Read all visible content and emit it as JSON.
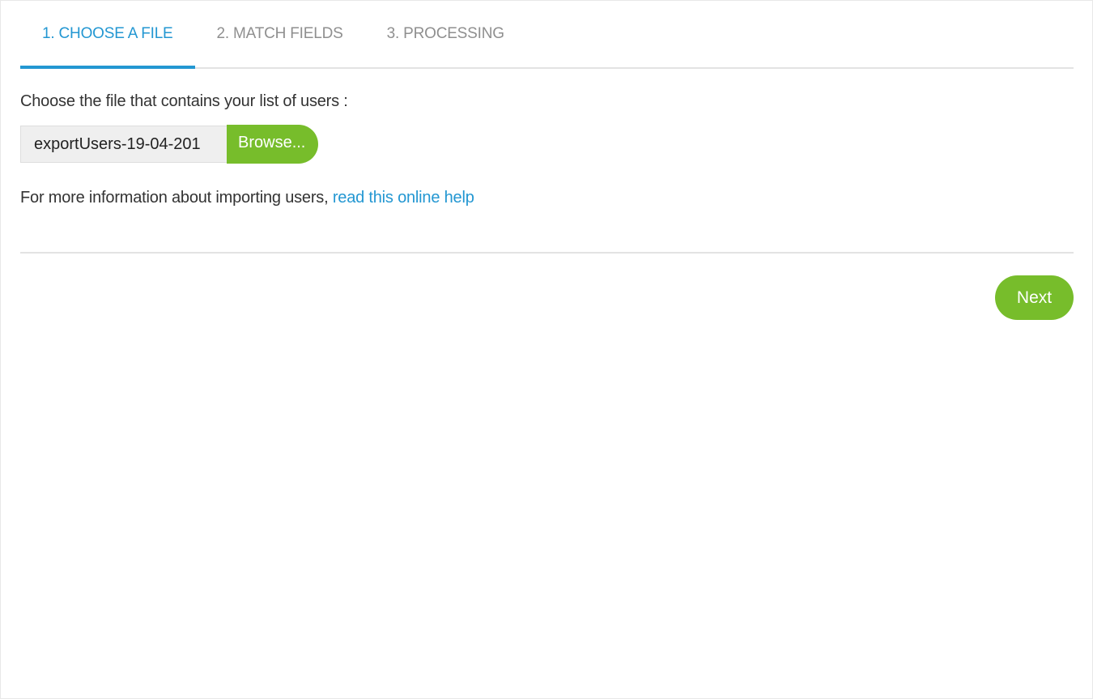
{
  "tabs": [
    {
      "label": "1. CHOOSE A FILE",
      "active": true
    },
    {
      "label": "2. MATCH FIELDS",
      "active": false
    },
    {
      "label": "3. PROCESSING",
      "active": false
    }
  ],
  "upload": {
    "prompt": "Choose the file that contains your list of users :",
    "file_name": "exportUsers-19-04-201",
    "browse_label": "Browse..."
  },
  "info": {
    "text": "For more information about importing users, ",
    "link_text": "read this online help"
  },
  "footer": {
    "next_label": "Next"
  },
  "colors": {
    "accent_blue": "#2397d2",
    "action_green": "#77bd2b",
    "inactive_tab": "#8f8f8f"
  }
}
